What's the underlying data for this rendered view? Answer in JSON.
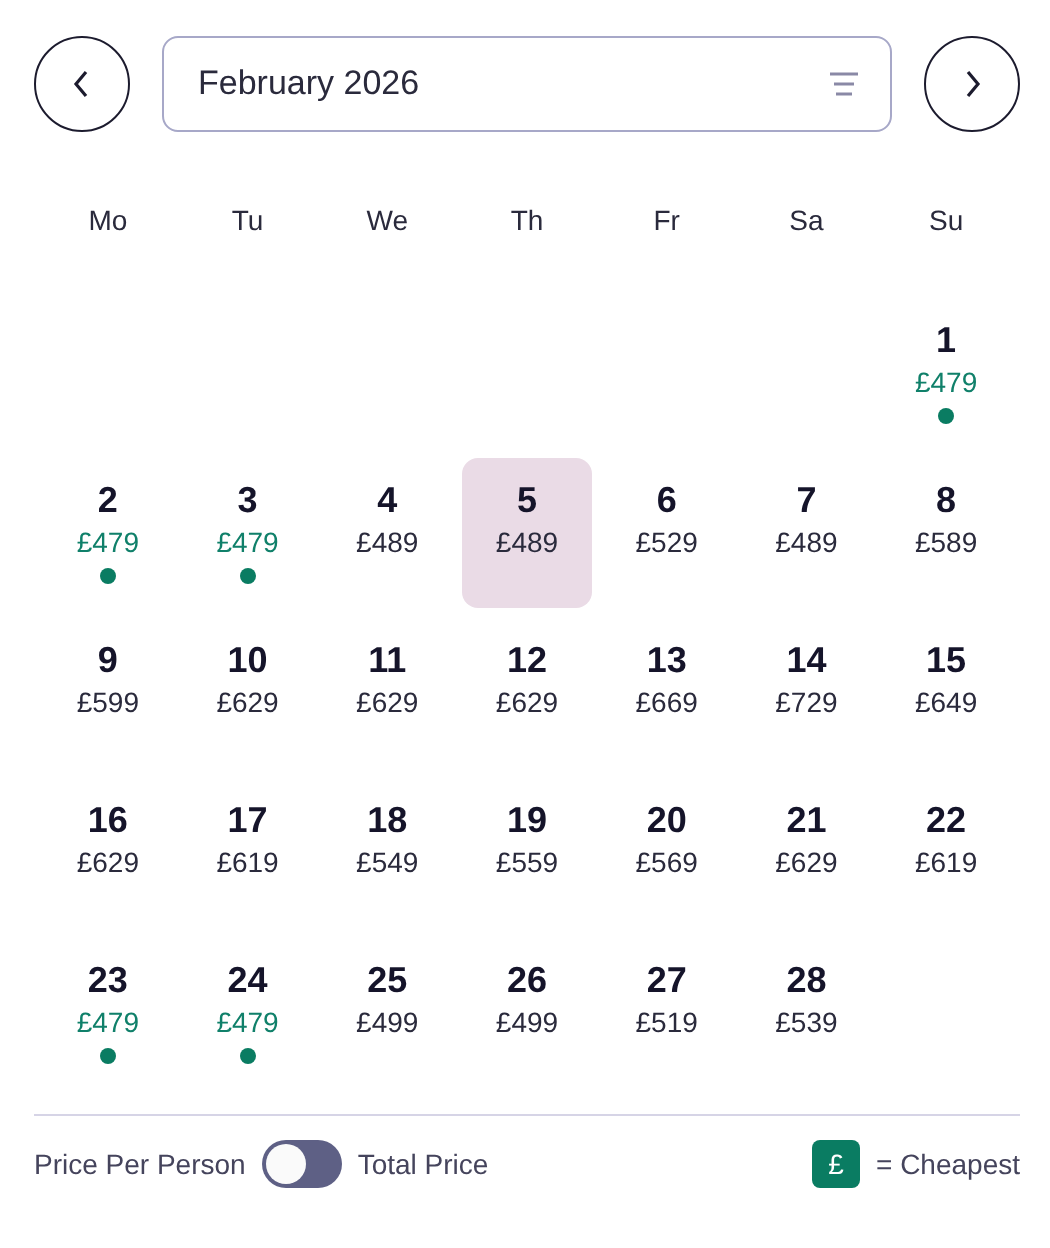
{
  "month_picker": {
    "value": "February 2026"
  },
  "weekdays": [
    "Mo",
    "Tu",
    "We",
    "Th",
    "Fr",
    "Sa",
    "Su"
  ],
  "weeks": [
    [
      {
        "day": "1",
        "price": "£479",
        "cheapest": true,
        "selected": false
      }
    ],
    [
      {
        "day": "2",
        "price": "£479",
        "cheapest": true,
        "selected": false
      },
      {
        "day": "3",
        "price": "£479",
        "cheapest": true,
        "selected": false
      },
      {
        "day": "4",
        "price": "£489",
        "cheapest": false,
        "selected": false
      },
      {
        "day": "5",
        "price": "£489",
        "cheapest": false,
        "selected": true
      },
      {
        "day": "6",
        "price": "£529",
        "cheapest": false,
        "selected": false
      },
      {
        "day": "7",
        "price": "£489",
        "cheapest": false,
        "selected": false
      },
      {
        "day": "8",
        "price": "£589",
        "cheapest": false,
        "selected": false
      }
    ],
    [
      {
        "day": "9",
        "price": "£599",
        "cheapest": false,
        "selected": false
      },
      {
        "day": "10",
        "price": "£629",
        "cheapest": false,
        "selected": false
      },
      {
        "day": "11",
        "price": "£629",
        "cheapest": false,
        "selected": false
      },
      {
        "day": "12",
        "price": "£629",
        "cheapest": false,
        "selected": false
      },
      {
        "day": "13",
        "price": "£669",
        "cheapest": false,
        "selected": false
      },
      {
        "day": "14",
        "price": "£729",
        "cheapest": false,
        "selected": false
      },
      {
        "day": "15",
        "price": "£649",
        "cheapest": false,
        "selected": false
      }
    ],
    [
      {
        "day": "16",
        "price": "£629",
        "cheapest": false,
        "selected": false
      },
      {
        "day": "17",
        "price": "£619",
        "cheapest": false,
        "selected": false
      },
      {
        "day": "18",
        "price": "£549",
        "cheapest": false,
        "selected": false
      },
      {
        "day": "19",
        "price": "£559",
        "cheapest": false,
        "selected": false
      },
      {
        "day": "20",
        "price": "£569",
        "cheapest": false,
        "selected": false
      },
      {
        "day": "21",
        "price": "£629",
        "cheapest": false,
        "selected": false
      },
      {
        "day": "22",
        "price": "£619",
        "cheapest": false,
        "selected": false
      }
    ],
    [
      {
        "day": "23",
        "price": "£479",
        "cheapest": true,
        "selected": false
      },
      {
        "day": "24",
        "price": "£479",
        "cheapest": true,
        "selected": false
      },
      {
        "day": "25",
        "price": "£499",
        "cheapest": false,
        "selected": false
      },
      {
        "day": "26",
        "price": "£499",
        "cheapest": false,
        "selected": false
      },
      {
        "day": "27",
        "price": "£519",
        "cheapest": false,
        "selected": false
      },
      {
        "day": "28",
        "price": "£539",
        "cheapest": false,
        "selected": false
      }
    ]
  ],
  "price_toggle": {
    "left_label": "Price Per Person",
    "right_label": "Total Price",
    "on": false
  },
  "legend": {
    "symbol": "£",
    "label": "= Cheapest"
  }
}
